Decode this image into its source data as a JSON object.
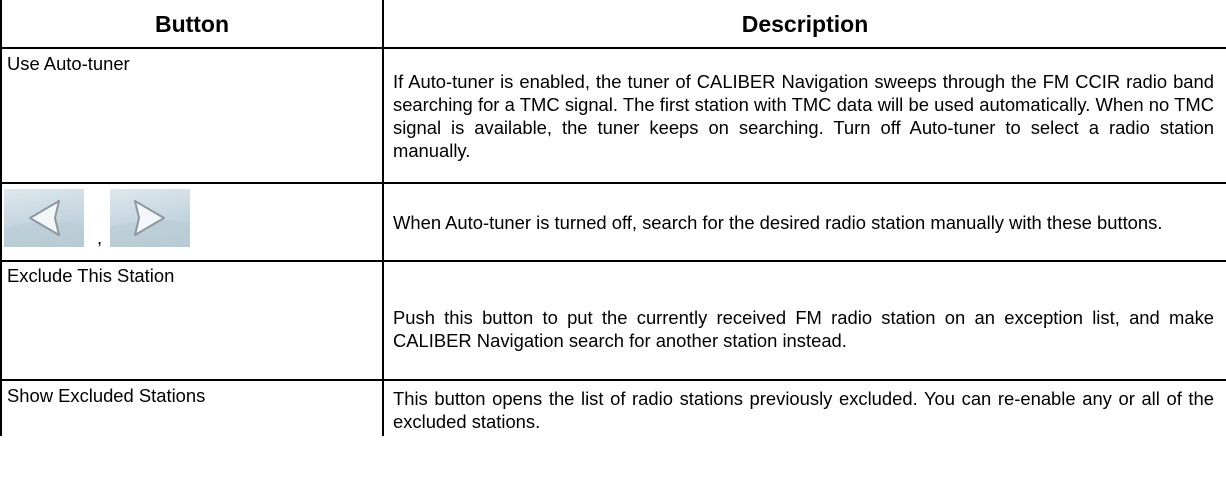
{
  "table": {
    "headers": {
      "button": "Button",
      "description": "Description"
    },
    "rows": [
      {
        "button": "Use Auto-tuner",
        "description": "If Auto-tuner is enabled, the tuner of CALIBER Navigation sweeps through the FM CCIR radio band searching for a TMC signal. The first station with TMC data will be used automatically. When no TMC signal is available, the tuner keeps on searching. Turn off Auto-tuner to select a radio station manually."
      },
      {
        "button_icons": [
          "arrow-left-icon",
          "arrow-right-icon"
        ],
        "button_separator": ",",
        "description": "When Auto-tuner is turned off, search for the desired radio station manually with these buttons."
      },
      {
        "button": "Exclude This Station",
        "description": "Push this button to put the currently received FM radio station on an exception list, and make CALIBER Navigation search for another station instead."
      },
      {
        "button": "Show Excluded Stations",
        "description": "This button opens the list of radio stations previously excluded. You can re-enable any or all of the excluded stations."
      }
    ]
  },
  "colors": {
    "border": "#000000",
    "arrow_button_bg": "#c9d8e1",
    "arrow_glyph_fill": "#f4f7f9",
    "arrow_glyph_stroke": "#8d98a0"
  }
}
